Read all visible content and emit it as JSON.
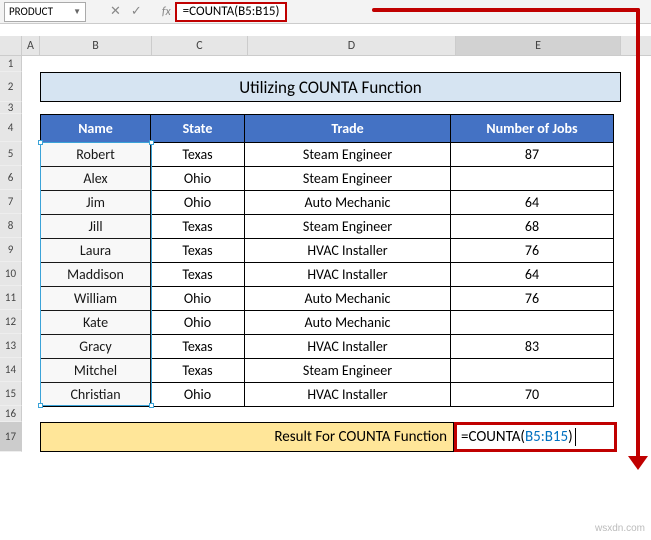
{
  "nameBox": "PRODUCT",
  "formulaBar": "=COUNTA(B5:B15)",
  "columns": [
    "A",
    "B",
    "C",
    "D",
    "E"
  ],
  "rowNumbers": [
    1,
    2,
    3,
    4,
    5,
    6,
    7,
    8,
    9,
    10,
    11,
    12,
    13,
    14,
    15,
    16,
    17
  ],
  "title": "Utilizing COUNTA Function",
  "headers": {
    "name": "Name",
    "state": "State",
    "trade": "Trade",
    "jobs": "Number of Jobs"
  },
  "rows": [
    {
      "name": "Robert",
      "state": "Texas",
      "trade": "Steam Engineer",
      "jobs": "87"
    },
    {
      "name": "Alex",
      "state": "Ohio",
      "trade": "Steam Engineer",
      "jobs": ""
    },
    {
      "name": "Jim",
      "state": "Ohio",
      "trade": "Auto Mechanic",
      "jobs": "64"
    },
    {
      "name": "Jill",
      "state": "Texas",
      "trade": "Steam Engineer",
      "jobs": "68"
    },
    {
      "name": "Laura",
      "state": "Texas",
      "trade": "HVAC Installer",
      "jobs": "76"
    },
    {
      "name": "Maddison",
      "state": "Texas",
      "trade": "HVAC Installer",
      "jobs": "64"
    },
    {
      "name": "William",
      "state": "Ohio",
      "trade": "Auto Mechanic",
      "jobs": "76"
    },
    {
      "name": "Kate",
      "state": "Ohio",
      "trade": "Auto Mechanic",
      "jobs": ""
    },
    {
      "name": "Gracy",
      "state": "Texas",
      "trade": "HVAC Installer",
      "jobs": "83"
    },
    {
      "name": "Mitchel",
      "state": "Texas",
      "trade": "Steam Engineer",
      "jobs": ""
    },
    {
      "name": "Christian",
      "state": "Ohio",
      "trade": "HVAC Installer",
      "jobs": "70"
    }
  ],
  "resultLabel": "Result For COUNTA Function",
  "resultCell": {
    "prefix": "=COUNTA(",
    "ref": "B5:B15",
    "suffix": ")"
  },
  "watermark": "wsxdn.com"
}
